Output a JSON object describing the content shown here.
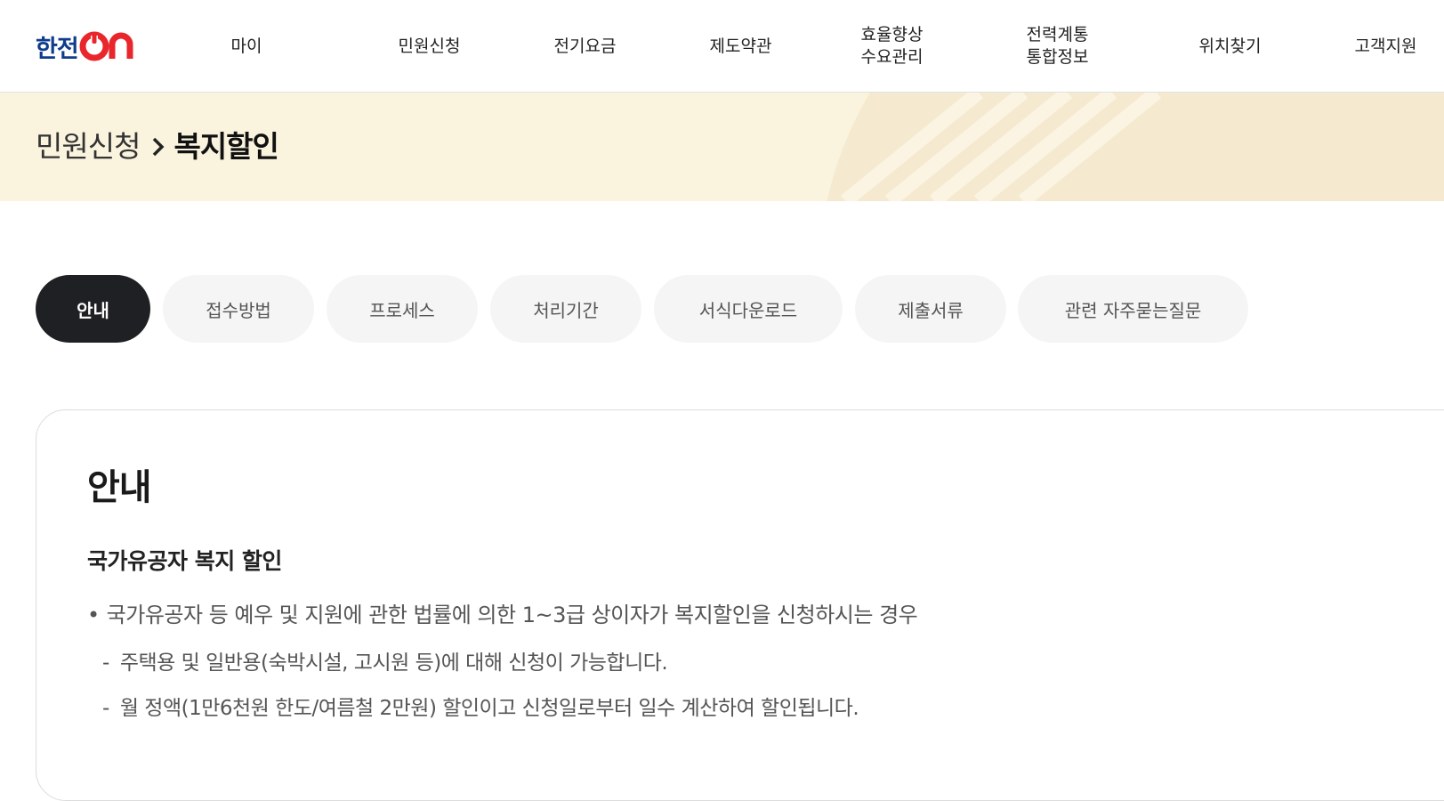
{
  "header": {
    "logo": {
      "text": "한전",
      "suffix": "ON"
    },
    "nav": [
      {
        "label": "마이"
      },
      {
        "label": "민원신청"
      },
      {
        "label": "전기요금"
      },
      {
        "label": "제도약관"
      },
      {
        "label": "효율향상\n수요관리"
      },
      {
        "label": "전력계통\n통합정보"
      },
      {
        "label": "위치찾기"
      },
      {
        "label": "고객지원"
      }
    ]
  },
  "breadcrumb": {
    "parent": "민원신청",
    "current": "복지할인"
  },
  "tabs": [
    {
      "label": "안내",
      "active": true
    },
    {
      "label": "접수방법",
      "active": false
    },
    {
      "label": "프로세스",
      "active": false
    },
    {
      "label": "처리기간",
      "active": false
    },
    {
      "label": "서식다운로드",
      "active": false
    },
    {
      "label": "제출서류",
      "active": false
    },
    {
      "label": "관련 자주묻는질문",
      "active": false
    }
  ],
  "content": {
    "title": "안내",
    "section_title": "국가유공자 복지 할인",
    "bullet": "국가유공자 등 예우 및 지원에 관한 법률에 의한 1~3급 상이자가 복지할인을 신청하시는 경우",
    "sub_items": [
      "주택용 및 일반용(숙박시설, 고시원 등)에 대해 신청이 가능합니다.",
      "월 정액(1만6천원 한도/여름철 2만원) 할인이고 신청일로부터 일수 계산하여 할인됩니다."
    ]
  },
  "colors": {
    "logo_blue": "#0f3d8c",
    "logo_red": "#e8262c",
    "banner_bg": "#faf3de",
    "active_tab": "#1f2023",
    "inactive_tab": "#f5f5f5"
  }
}
